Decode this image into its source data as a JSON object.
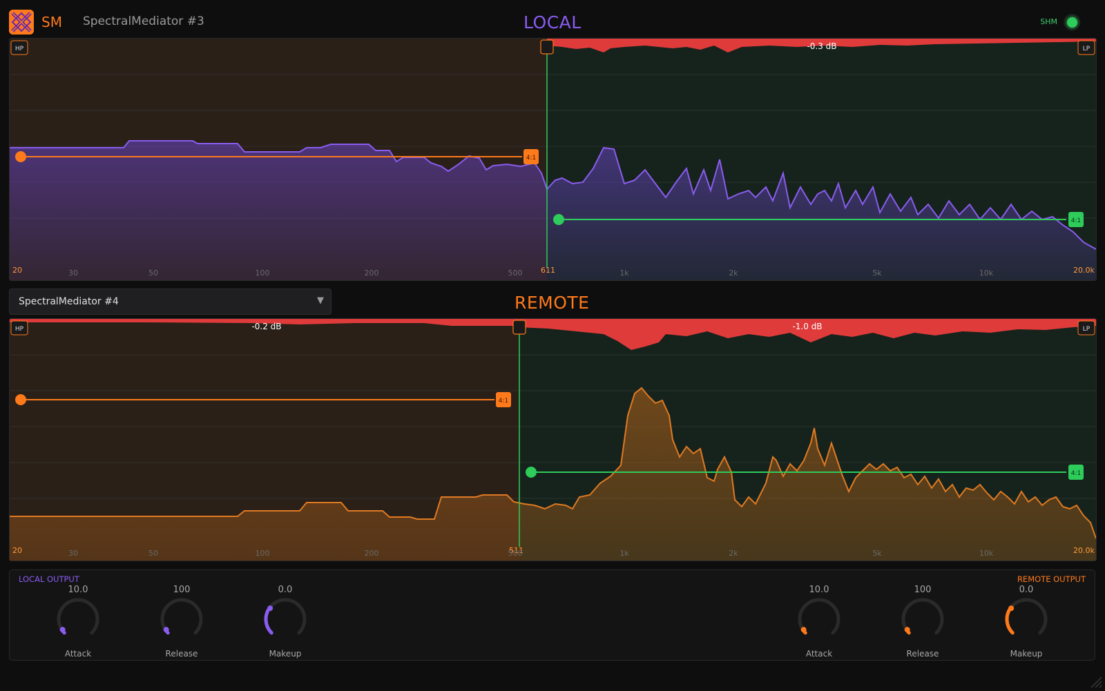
{
  "header": {
    "brand": "SM",
    "instance_name": "SpectralMediator #3",
    "shm_label": "SHM"
  },
  "colors": {
    "local_accent": "#8a5cf0",
    "remote_accent": "#ff7a1a",
    "green_accent": "#2ecc5a",
    "gain_reduction": "#e03b3b",
    "low_band_bg": "#2a2018",
    "high_band_bg": "#16231c"
  },
  "local": {
    "title": "LOCAL",
    "hp_label": "HP",
    "lp_label": "LP",
    "crossover_label": "611",
    "low_ratio_label": "4:1",
    "high_ratio_label": "4:1",
    "gain_reduction_label": "-0.3 dB",
    "freq_min_label": "20",
    "freq_max_label": "20.0k",
    "freq_ticks": [
      "30",
      "50",
      "100",
      "200",
      "500",
      "1k",
      "2k",
      "5k",
      "10k"
    ]
  },
  "remote": {
    "source_dropdown": "SpectralMediator #4",
    "title": "REMOTE",
    "hp_label": "HP",
    "lp_label": "LP",
    "crossover_label": "511",
    "low_ratio_label": "4:1",
    "high_ratio_label": "4:1",
    "low_gain_reduction_label": "-0.2 dB",
    "high_gain_reduction_label": "-1.0 dB",
    "freq_min_label": "20",
    "freq_max_label": "20.0k",
    "freq_ticks": [
      "30",
      "50",
      "100",
      "200",
      "500",
      "1k",
      "2k",
      "5k",
      "10k"
    ]
  },
  "outputs": {
    "local_label": "LOCAL OUTPUT",
    "remote_label": "REMOTE OUTPUT",
    "local_knobs": [
      {
        "label": "Attack",
        "value": "10.0",
        "level": 0.04
      },
      {
        "label": "Release",
        "value": "100",
        "level": 0.04
      },
      {
        "label": "Makeup",
        "value": "0.0",
        "level": 0.3
      }
    ],
    "remote_knobs": [
      {
        "label": "Attack",
        "value": "10.0",
        "level": 0.04
      },
      {
        "label": "Release",
        "value": "100",
        "level": 0.04
      },
      {
        "label": "Makeup",
        "value": "0.0",
        "level": 0.3
      }
    ]
  }
}
